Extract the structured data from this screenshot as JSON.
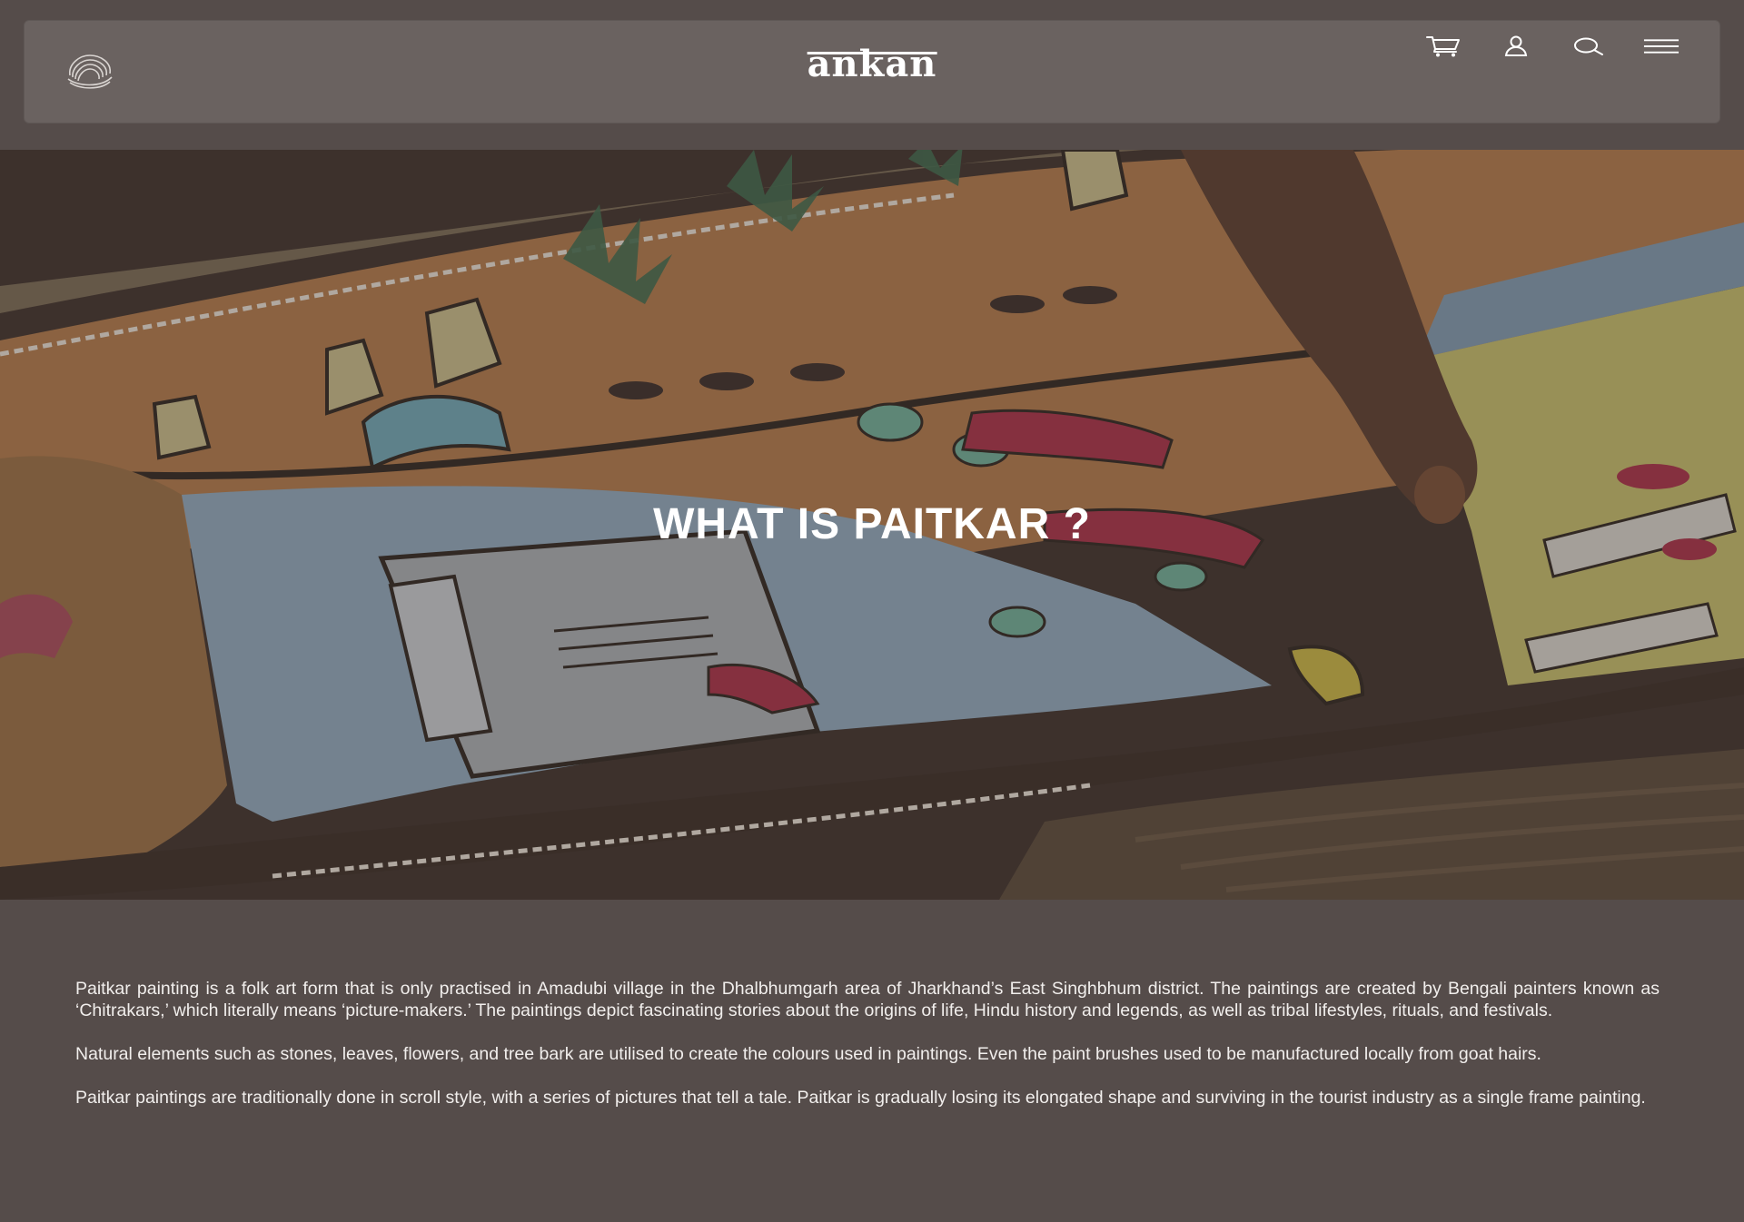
{
  "header": {
    "logo_text": "ankan",
    "icons": [
      "swirl-emblem-icon",
      "cart-icon",
      "user-icon",
      "search-icon",
      "menu-icon"
    ]
  },
  "hero": {
    "title": "WHAT IS PAITKAR ?"
  },
  "content": {
    "paragraphs": [
      "Paitkar painting is a folk art form that is only practised in Amadubi village in the Dhalbhumgarh area of Jharkhand’s East Singhbhum district. The paintings are created by Bengali painters known as ‘Chitrakars,’ which literally means ‘picture-makers.’ The paintings depict fascinating stories about the origins of life, Hindu history and legends, as well as tribal lifestyles, rituals, and festivals.",
      "Natural elements such as stones, leaves, flowers, and tree bark are utilised to create the colours used in paintings. Even the paint brushes used to be manufactured locally from goat hairs.",
      "Paitkar paintings are traditionally done in scroll style, with a series of pictures that tell a tale. Paitkar is gradually losing its elongated shape and surviving in the tourist industry as a single frame painting."
    ]
  },
  "colors": {
    "page_background": "#554c4a",
    "header_background": "#6a6260",
    "text": "#f1eeec"
  }
}
